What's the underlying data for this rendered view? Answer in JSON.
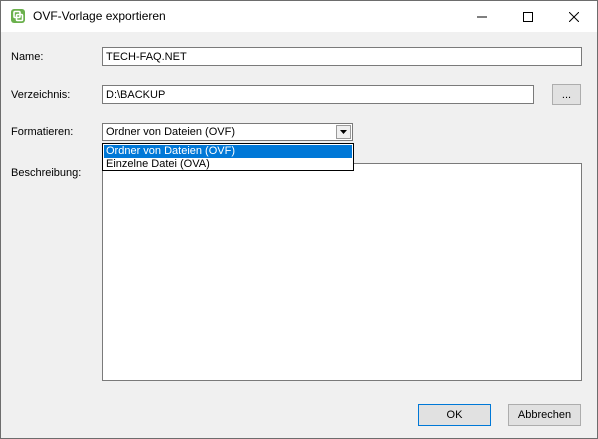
{
  "window": {
    "title": "OVF-Vorlage exportieren",
    "icons": {
      "app": "vsphere-icon",
      "minimize": "minimize-icon",
      "maximize": "maximize-icon",
      "close": "close-icon"
    }
  },
  "form": {
    "name_label": "Name:",
    "name_value": "TECH-FAQ.NET",
    "directory_label": "Verzeichnis:",
    "directory_value": "D:\\BACKUP",
    "browse_label": "...",
    "format_label": "Formatieren:",
    "format_selected": "Ordner von Dateien (OVF)",
    "format_options": [
      "Ordner von Dateien (OVF)",
      "Einzelne Datei (OVA)"
    ],
    "description_label": "Beschreibung:",
    "description_value": ""
  },
  "buttons": {
    "ok": "OK",
    "cancel": "Abbrechen"
  },
  "colors": {
    "highlight": "#0078d7",
    "dialog_bg": "#f0f0f0",
    "icon_green": "#6ab04c"
  }
}
